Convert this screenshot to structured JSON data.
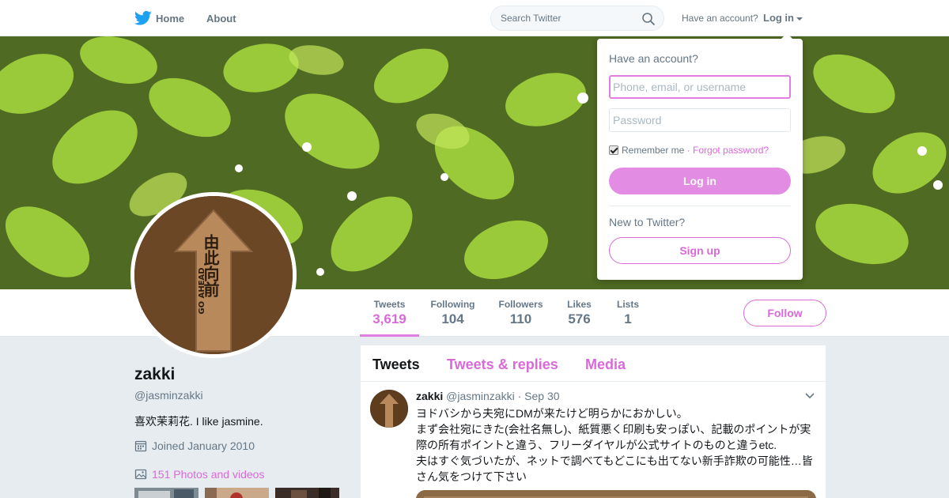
{
  "colors": {
    "accent": "#d96ad8",
    "twitter_blue": "#1da1f2",
    "background": "#e6ecf0"
  },
  "nav": {
    "logo_icon": "twitter-bird-icon",
    "home_label": "Home",
    "about_label": "About",
    "search_placeholder": "Search Twitter",
    "search_icon": "search-icon",
    "have_account_text": "Have an account?",
    "login_label": "Log in"
  },
  "login_dropdown": {
    "title": "Have an account?",
    "username_placeholder": "Phone, email, or username",
    "password_placeholder": "Password",
    "remember_label": "Remember me",
    "separator": " · ",
    "forgot_label": "Forgot password?",
    "remember_checked": true,
    "login_button": "Log in",
    "new_text": "New to Twitter?",
    "signup_button": "Sign up"
  },
  "profile": {
    "name": "zakki",
    "handle": "@jasminzakki",
    "bio": "喜欢茉莉花. I like jasmine.",
    "joined": "Joined January 2010",
    "photos_link": "151 Photos and videos",
    "avatar_text_cn": "由此向前",
    "avatar_text_en": "GO AHEAD"
  },
  "stats": [
    {
      "label": "Tweets",
      "value": "3,619",
      "active": true
    },
    {
      "label": "Following",
      "value": "104",
      "active": false
    },
    {
      "label": "Followers",
      "value": "110",
      "active": false
    },
    {
      "label": "Likes",
      "value": "576",
      "active": false
    },
    {
      "label": "Lists",
      "value": "1",
      "active": false
    }
  ],
  "follow_button": "Follow",
  "timeline": {
    "tabs": [
      {
        "label": "Tweets",
        "active": true
      },
      {
        "label": "Tweets & replies",
        "active": false
      },
      {
        "label": "Media",
        "active": false
      }
    ],
    "tweet": {
      "name": "zakki",
      "handle": "@jasminzakki",
      "separator": "·",
      "date": "Sep 30",
      "lines": [
        "ヨドバシから夫宛にDMが来たけど明らかにおかしい。",
        "まず会社宛にきた(会社名無し)、紙質悪く印刷も安っぽい、記載のポイントが実際の所有ポイントと違う、フリーダイヤルが公式サイトのものと違うetc.",
        "夫はすぐ気づいたが、ネットで調べてもどこにも出てない新手詐欺の可能性…皆さん気をつけて下さい"
      ]
    }
  }
}
